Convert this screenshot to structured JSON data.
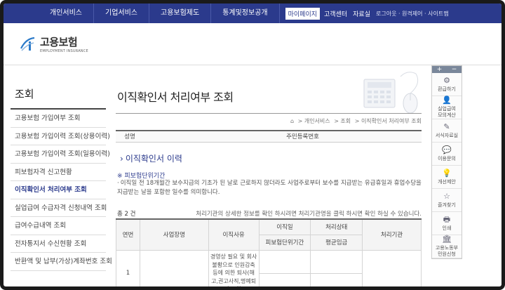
{
  "topnav": {
    "menu": [
      "개인서비스",
      "기업서비스",
      "고용보험제도",
      "통계및정보공개"
    ],
    "utils_boxed": [
      "마이페이지",
      "고객센터",
      "자료실"
    ],
    "utils_small": "로그아웃 · 원격제어 · 사이트맵"
  },
  "logo": {
    "ko": "고용보험",
    "en": "EMPLOYMENT INSURANCE",
    "accent_color": "#2b7ac9"
  },
  "sidebar": {
    "title": "조회",
    "items": [
      "고용보험 가입여부 조회",
      "고용보험 가입이력 조회(상용이력)",
      "고용보험 가입이력 조회(일용이력)",
      "피보험자격 신고현황",
      "이직확인서 처리여부 조회",
      "실업급여 수급자격 신청내역 조회",
      "급여수급내역 조회",
      "전자통지서 수신현황 조회",
      "반환액 및 납부(가상)계좌번호 조회"
    ],
    "active_index": 4
  },
  "main": {
    "title": "이직확인서 처리여부 조회",
    "breadcrumb": [
      "⌂",
      "> 개인서비스",
      "> 조회",
      "> 이직확인서 처리여부 조회"
    ],
    "info": {
      "name_label": "성명",
      "name_value": "",
      "rrn_label": "주민등록번호"
    },
    "section": "이직확인서 이력",
    "subsection": "※ 피보험단위기간",
    "description": "이직일 전 18개월간 보수지급의 기초가 된 날로 근로하지 않더라도 사업주로부터 보수를 지급받는 유급휴일과 휴업수당을 지급받는 날을 포함한 일수를 의미합니다.",
    "count": "총 2 건",
    "note": "처리기관의 상세한 정보를 확인 하시려면 처리기관명을 클릭 하시면 확인 하실 수 있습니다.",
    "table": {
      "headers": {
        "no": "연번",
        "company": "사업장명",
        "reason": "이직사유",
        "separation_date": "이직일",
        "period": "피보험단위기간",
        "status": "처리상태",
        "avg_wage": "평균임금",
        "agency": "처리기관"
      },
      "rows": [
        {
          "no": "1",
          "company": "",
          "reason": "경영상 필요 및 회사불황으로 인원감축 등에 의한 퇴사(해고,권고사직,명예퇴직 포함)",
          "separation_date": "",
          "period": "",
          "status": "",
          "avg_wage": "",
          "agency": ""
        }
      ]
    }
  },
  "quick": {
    "plus": "+",
    "minus": "−",
    "items": [
      {
        "icon": "⚙",
        "label": "환급하기",
        "name": "refund"
      },
      {
        "icon": "👤",
        "label": "실업급여\n모의계산",
        "name": "calc"
      },
      {
        "icon": "✎",
        "label": "서식자료실",
        "name": "forms"
      },
      {
        "icon": "💬",
        "label": "이용문의",
        "name": "inquiry"
      },
      {
        "icon": "💡",
        "label": "개선제안",
        "name": "suggest"
      },
      {
        "icon": "☆",
        "label": "즐겨찾기",
        "name": "favorite"
      },
      {
        "icon": "🖶",
        "label": "인쇄",
        "name": "print"
      },
      {
        "icon": "🏛",
        "label": "고용노동부\n민원신청",
        "name": "moel"
      }
    ]
  }
}
